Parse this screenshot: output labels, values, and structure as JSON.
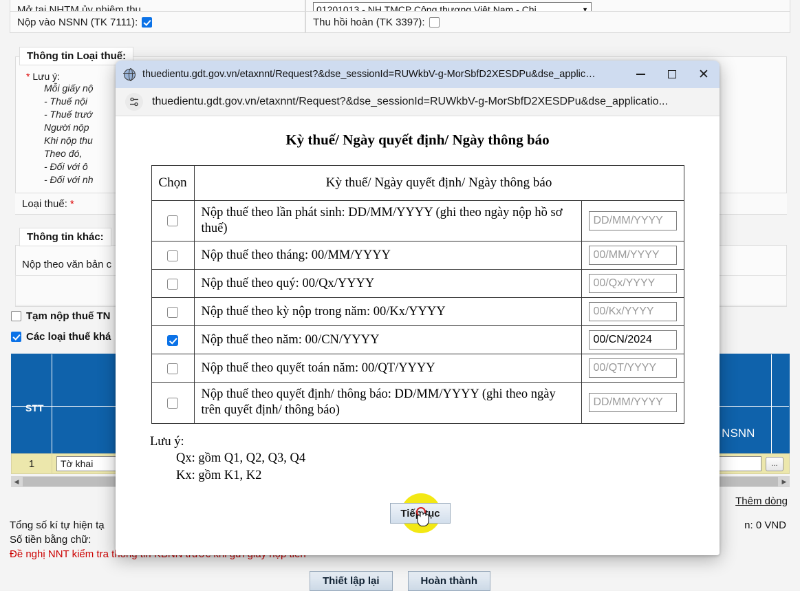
{
  "background_form": {
    "top_label": "Mở tại NHTM ủy nhiệm thu",
    "bank_select_value": "01201013 - NH TMCP Công thương Việt Nam - Chi",
    "nsnn_label": "Nộp vào NSNN (TK 7111):",
    "nsnn_checked": true,
    "thuhoi_label": "Thu hồi hoàn (TK 3397):",
    "thuhoi_checked": false,
    "group_loaithue_legend": "Thông tin Loại thuế:",
    "note_star": "*",
    "note_label": "Lưu ý:",
    "note_lines": [
      "Mỗi giấy nộ",
      "- Thuế nội ",
      "- Thuế trướ",
      "Người nộp",
      "Khi nộp thu",
      "Theo đó,",
      "- Đối với ô ",
      "- Đối với nh"
    ],
    "loaithue_label": "Loại thuế:",
    "loaithue_star": "*",
    "group_khac_legend": "Thông tin khác:",
    "nopvb_label": "Nộp theo văn bản c",
    "chk_tamnop_label": "Tạm nộp thuế TN",
    "chk_tamnop_checked": false,
    "chk_cacloai_label": "Các loại thuế khá",
    "chk_cacloai_checked": true,
    "table_header_stt": "STT",
    "table_header_nsnn": "o NSNN",
    "row_stt": "1",
    "row_tokhai": "Tờ khai",
    "row_dots_button": "...",
    "add_row_link": "Thêm dòng",
    "summary_line1": "Tổng số kí tự hiện tạ",
    "summary_line2": "Số tiền bằng chữ:",
    "summary_line3": "Đề nghị NNT kiểm tra thông tin KBNN trước khi gửi giấy nộp tiền",
    "summary_right": "n: 0 VND",
    "btn_reset": "Thiết lập lại",
    "btn_finish": "Hoàn thành",
    "blue_color": "#0f62ab",
    "row_yellow": "#ece7ac"
  },
  "dialog": {
    "window_title": "thuedientu.gdt.gov.vn/etaxnnt/Request?&dse_sessionId=RUWkbV-g-MorSbfD2XESDPu&dse_applica...",
    "address": "thuedientu.gdt.gov.vn/etaxnnt/Request?&dse_sessionId=RUWkbV-g-MorSbfD2XESDPu&dse_applicatio...",
    "globe_icon": "globe-icon",
    "permissions_icon": "permissions-icon",
    "minimize_icon": "minimize-icon",
    "maximize_icon": "maximize-icon",
    "close_icon": "close-icon",
    "heading": "Kỳ thuế/ Ngày quyết định/ Ngày thông báo",
    "table": {
      "headers": [
        "Chọn",
        "Kỳ thuế/ Ngày quyết định/ Ngày thông báo"
      ],
      "rows": [
        {
          "checked": false,
          "label": "Nộp thuế theo lần phát sinh: DD/MM/YYYY (ghi theo ngày nộp hồ sơ thuế)",
          "value": "",
          "placeholder": "DD/MM/YYYY"
        },
        {
          "checked": false,
          "label": "Nộp thuế theo tháng: 00/MM/YYYY",
          "value": "",
          "placeholder": "00/MM/YYYY"
        },
        {
          "checked": false,
          "label": "Nộp thuế theo quý: 00/Qx/YYYY",
          "value": "",
          "placeholder": "00/Qx/YYYY"
        },
        {
          "checked": false,
          "label": "Nộp thuế theo kỳ nộp trong năm: 00/Kx/YYYY",
          "value": "",
          "placeholder": "00/Kx/YYYY"
        },
        {
          "checked": true,
          "label": "Nộp thuế theo năm: 00/CN/YYYY",
          "value": "00/CN/2024",
          "placeholder": "00/CN/YYYY"
        },
        {
          "checked": false,
          "label": "Nộp thuế theo quyết toán năm: 00/QT/YYYY",
          "value": "",
          "placeholder": "00/QT/YYYY"
        },
        {
          "checked": false,
          "label": "Nộp thuế theo quyết định/ thông báo: DD/MM/YYYY (ghi theo ngày trên quyết định/ thông báo)",
          "value": "",
          "placeholder": "DD/MM/YYYY"
        }
      ]
    },
    "notes": {
      "title": "Lưu ý:",
      "lines": [
        "Qx: gồm Q1, Q2, Q3, Q4",
        "Kx: gồm K1, K2"
      ]
    },
    "continue_button": "Tiếp tục",
    "click_highlight_color": "#f2e600"
  }
}
